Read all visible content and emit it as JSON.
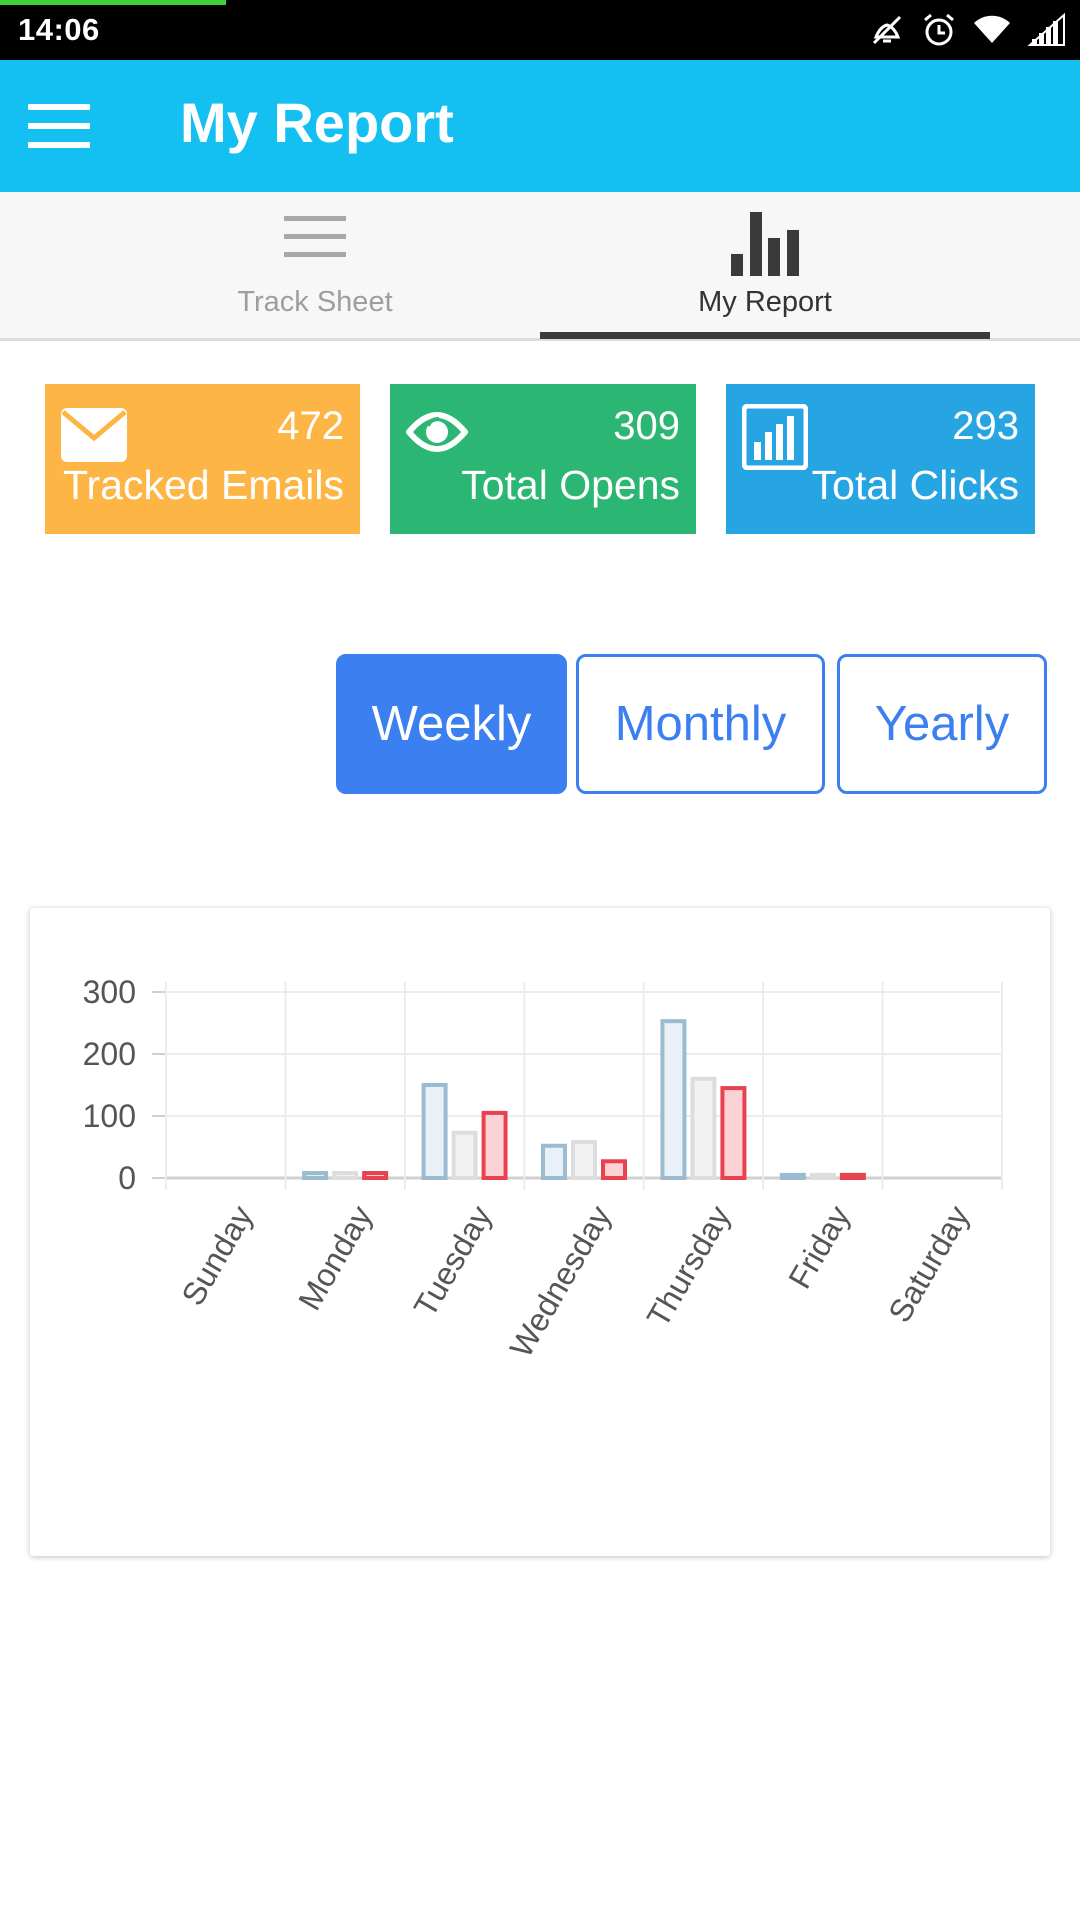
{
  "status_bar": {
    "time": "14:06",
    "icons": [
      "vibrate-off-icon",
      "alarm-icon",
      "wifi-icon",
      "signal-icon"
    ]
  },
  "app_bar": {
    "title": "My Report",
    "menu_icon": "hamburger-menu-icon",
    "color": "#13c0f1"
  },
  "tabs": [
    {
      "label": "Track Sheet",
      "icon": "list-icon",
      "active": false
    },
    {
      "label": "My Report",
      "icon": "bar-chart-icon",
      "active": true
    }
  ],
  "stats": [
    {
      "value": "472",
      "label": "Tracked Emails",
      "icon": "envelope-icon",
      "color": "#fdb645"
    },
    {
      "value": "309",
      "label": "Total Opens",
      "icon": "eye-icon",
      "color": "#2bb673"
    },
    {
      "value": "293",
      "label": "Total Clicks",
      "icon": "bar-chart-icon",
      "color": "#27a5e2"
    }
  ],
  "periods": [
    {
      "label": "Weekly",
      "active": true
    },
    {
      "label": "Monthly",
      "active": false
    },
    {
      "label": "Yearly",
      "active": false
    }
  ],
  "accent_color": "#3b7ff0",
  "chart_data": {
    "type": "bar",
    "categories": [
      "Sunday",
      "Monday",
      "Tuesday",
      "Wednesday",
      "Thursday",
      "Friday",
      "Saturday"
    ],
    "series": [
      {
        "values": [
          0,
          8,
          150,
          52,
          253,
          5,
          0
        ],
        "color": "#9bbbd0",
        "fill": "#e9f0f7"
      },
      {
        "values": [
          0,
          8,
          73,
          58,
          160,
          5,
          0
        ],
        "color": "#dddddd",
        "fill": "#f2f2f2"
      },
      {
        "values": [
          0,
          8,
          105,
          27,
          145,
          5,
          0
        ],
        "color": "#e8424f",
        "fill": "#fbd3d6"
      }
    ],
    "yticks": [
      0,
      100,
      200,
      300
    ],
    "ylim": [
      0,
      300
    ],
    "grid": true
  }
}
